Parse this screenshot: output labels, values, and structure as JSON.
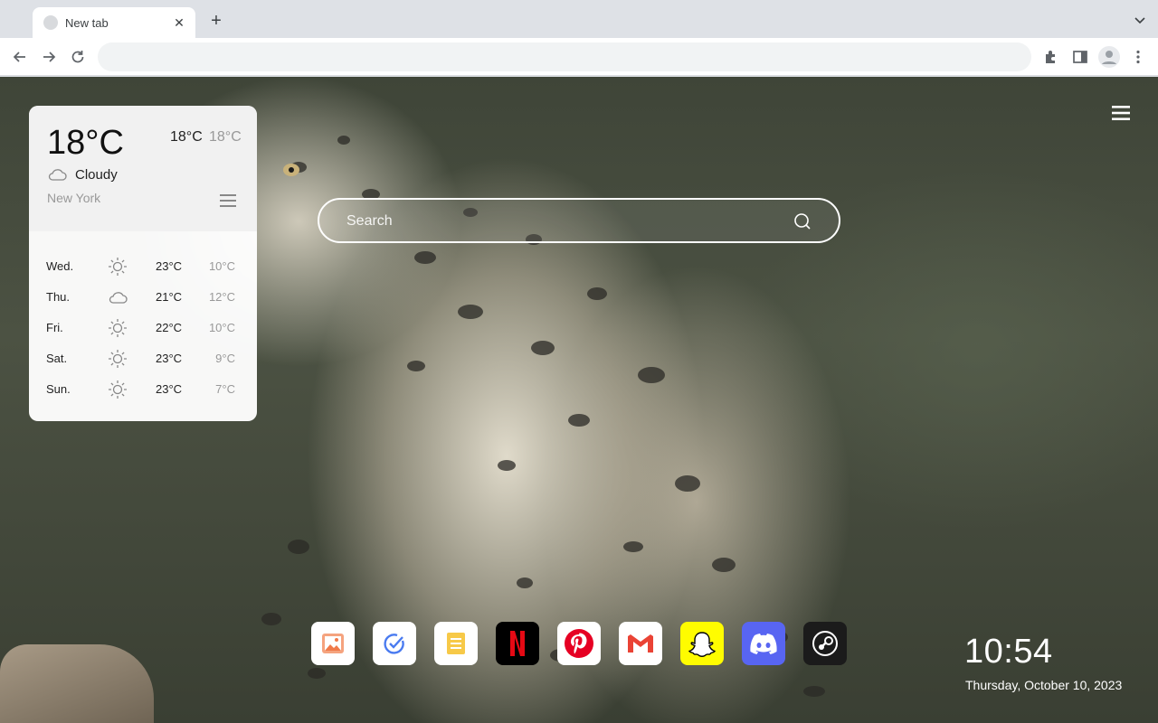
{
  "browser": {
    "tab": {
      "title": "New tab",
      "close_icon": "close-icon"
    },
    "new_tab_icon": "plus-icon",
    "tab_search_icon": "chevron-down-icon",
    "nav": {
      "back_icon": "arrow-left-icon",
      "forward_icon": "arrow-right-icon",
      "reload_icon": "reload-icon"
    },
    "omnibox": {
      "value": "",
      "placeholder": ""
    },
    "toolbar_icons": [
      "puzzle-icon",
      "side-panel-icon",
      "profile-icon",
      "kebab-menu-icon"
    ]
  },
  "weather": {
    "current_temp": "18°C",
    "high": "18°C",
    "low": "18°C",
    "condition": "Cloudy",
    "city": "New York",
    "forecast": [
      {
        "day": "Wed.",
        "icon": "sun-icon",
        "high": "23°C",
        "low": "10°C"
      },
      {
        "day": "Thu.",
        "icon": "cloud-icon",
        "high": "21°C",
        "low": "12°C"
      },
      {
        "day": "Fri.",
        "icon": "sun-icon",
        "high": "22°C",
        "low": "10°C"
      },
      {
        "day": "Sat.",
        "icon": "sun-icon",
        "high": "23°C",
        "low": "9°C"
      },
      {
        "day": "Sun.",
        "icon": "sun-icon",
        "high": "23°C",
        "low": "7°C"
      }
    ]
  },
  "search": {
    "placeholder": "Search"
  },
  "shortcuts": [
    {
      "name": "photos-app-icon"
    },
    {
      "name": "tasks-app-icon"
    },
    {
      "name": "notes-app-icon"
    },
    {
      "name": "netflix-app-icon"
    },
    {
      "name": "pinterest-app-icon"
    },
    {
      "name": "gmail-app-icon"
    },
    {
      "name": "snapchat-app-icon"
    },
    {
      "name": "discord-app-icon"
    },
    {
      "name": "steam-app-icon"
    }
  ],
  "clock": {
    "time": "10:54",
    "date": "Thursday, October 10, 2023"
  },
  "colors": {
    "netflix": "#e50914",
    "pinterest": "#e60023",
    "snapchat": "#fffc00",
    "discord": "#5865f2",
    "steam": "#1b1b1b"
  }
}
